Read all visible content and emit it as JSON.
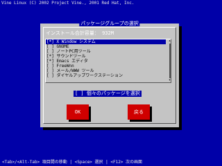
{
  "copyright": "Vine Linux (C) 2002 Project Vine., 2001 Red Hat, Inc.",
  "dialog": {
    "title": "パッケージグループの選択",
    "install_size_label": "インストール合計容量：  932M",
    "groups": [
      {
        "check": "[*]",
        "label": "X Window システム",
        "selected": true
      },
      {
        "check": "[ ]",
        "label": "GNOME"
      },
      {
        "check": "[ ]",
        "label": "ノートPC用ツール"
      },
      {
        "check": "[*]",
        "label": "サウンドツール"
      },
      {
        "check": "[*]",
        "label": "Emacs エディタ"
      },
      {
        "check": "[ ]",
        "label": "FreeWnn"
      },
      {
        "check": "[ ]",
        "label": "メール/WWW ツール"
      },
      {
        "check": "[ ]",
        "label": "ダイヤルアップワークステーション"
      }
    ],
    "individual_check": "[ ] 個々のパッケージを選択",
    "ok_label": "OK",
    "back_label": "戻る"
  },
  "help_line": "<Tab>/<Alt-Tab> 項目間の移動 | <Space> 選択  | <F12> 次の画面",
  "colors": {
    "screen": "#0000a8",
    "dialog": "#c4c4c4",
    "button": "#d00000",
    "highlight": "#0000a8"
  }
}
